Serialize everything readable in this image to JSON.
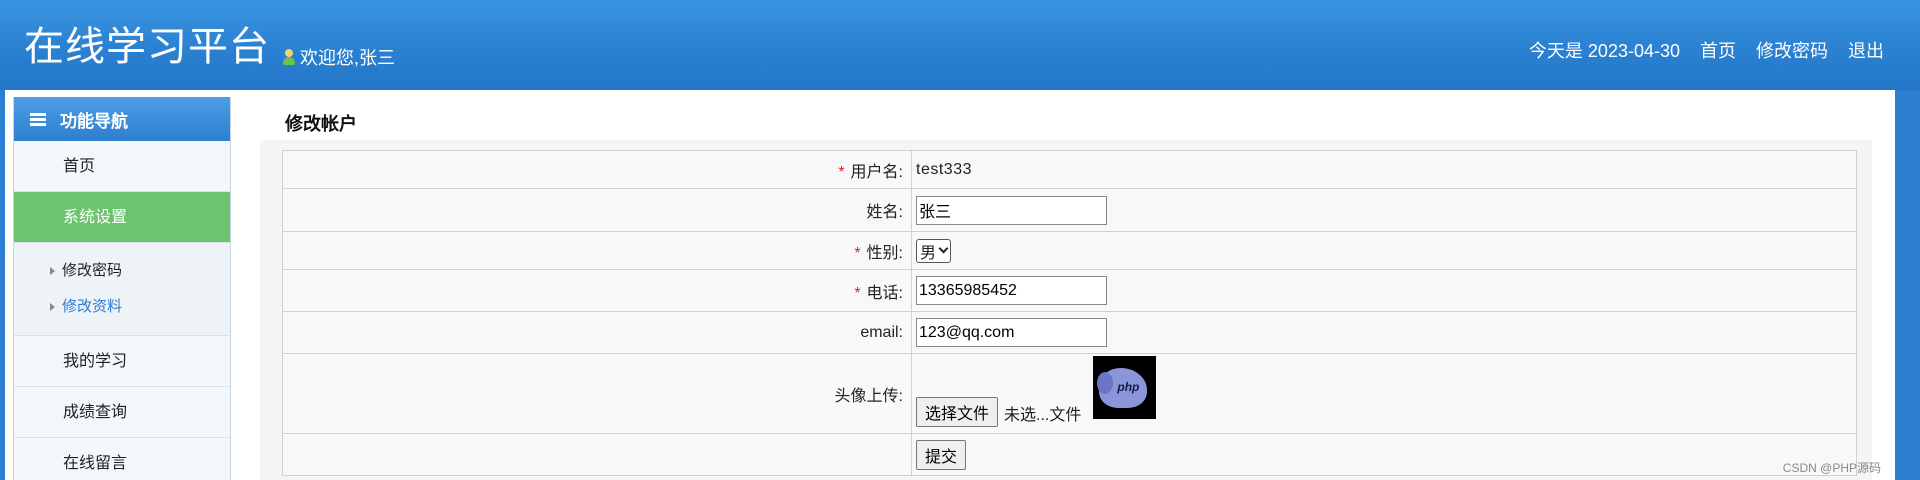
{
  "header": {
    "title": "在线学习平台",
    "welcome": "欢迎您,张三",
    "date_text": "今天是 2023-04-30",
    "links": [
      "首页",
      "修改密码",
      "退出"
    ]
  },
  "sidebar": {
    "heading": "功能导航",
    "items": [
      "首页",
      "系统设置"
    ],
    "sub_items": [
      "修改密码",
      "修改资料"
    ],
    "more_items": [
      "我的学习",
      "成绩查询",
      "在线留言"
    ]
  },
  "page": {
    "title": "修改帐户"
  },
  "form": {
    "username_label": "用户名:",
    "username_value": "test333",
    "name_label": "姓名:",
    "name_value": "张三",
    "gender_label": "性别:",
    "gender_value": "男",
    "phone_label": "电话:",
    "phone_value": "13365985452",
    "email_label": "email:",
    "email_value": "123@qq.com",
    "avatar_label": "头像上传:",
    "file_button": "选择文件",
    "file_status": "未选...文件",
    "avatar_image_text": "php",
    "submit_label": "提交"
  },
  "watermark": "CSDN @PHP源码"
}
